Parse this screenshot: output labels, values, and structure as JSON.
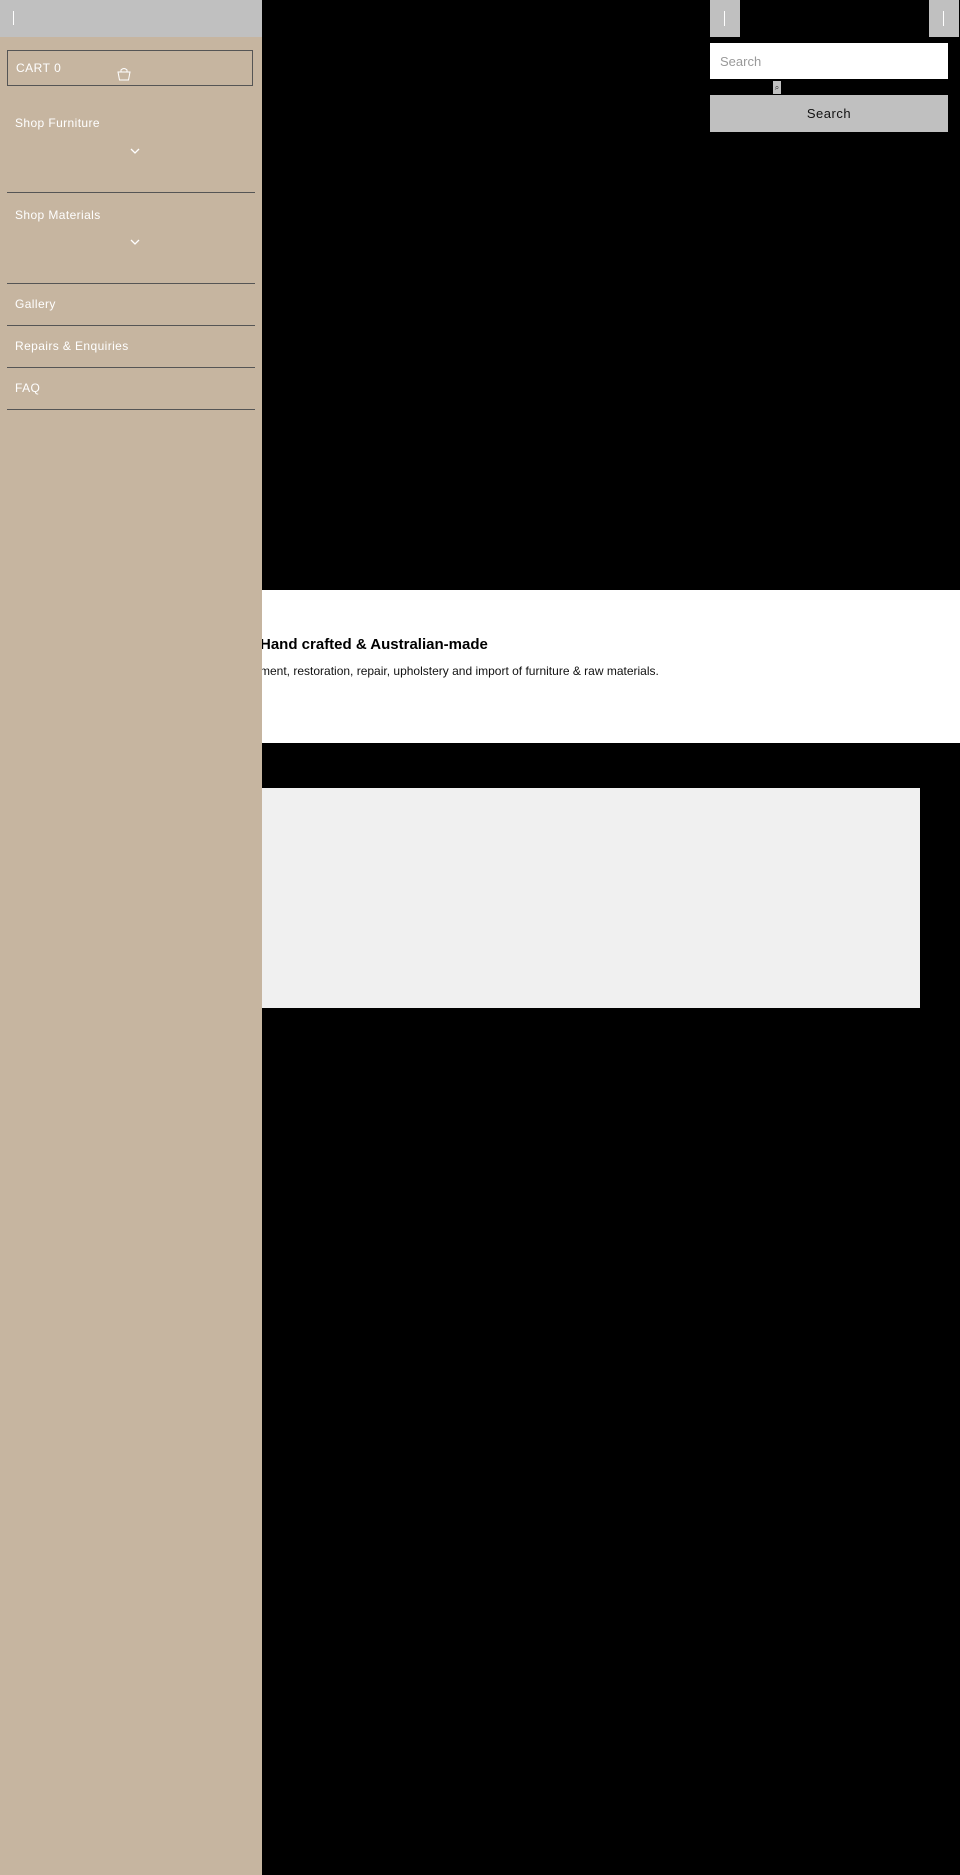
{
  "drawer": {
    "cart_label": "CART 0",
    "cart_icon": "shopping-bag-icon",
    "items": [
      {
        "label": "Shop Furniture",
        "expandable": true
      },
      {
        "label": "Shop Materials",
        "expandable": true
      },
      {
        "label": "Gallery",
        "expandable": false
      },
      {
        "label": "Repairs & Enquiries",
        "expandable": false
      },
      {
        "label": "FAQ",
        "expandable": false
      }
    ]
  },
  "search": {
    "placeholder": "Search",
    "value": "",
    "button_label": "Search"
  },
  "feature": {
    "title": "Hand crafted & Australian-made",
    "text": "ment, restoration, repair, upholstery and import of furniture & raw materials."
  },
  "colors": {
    "drawer_bg": "#c6b5a0",
    "control_bg": "#c0c0c0",
    "page_bg": "#000000"
  }
}
